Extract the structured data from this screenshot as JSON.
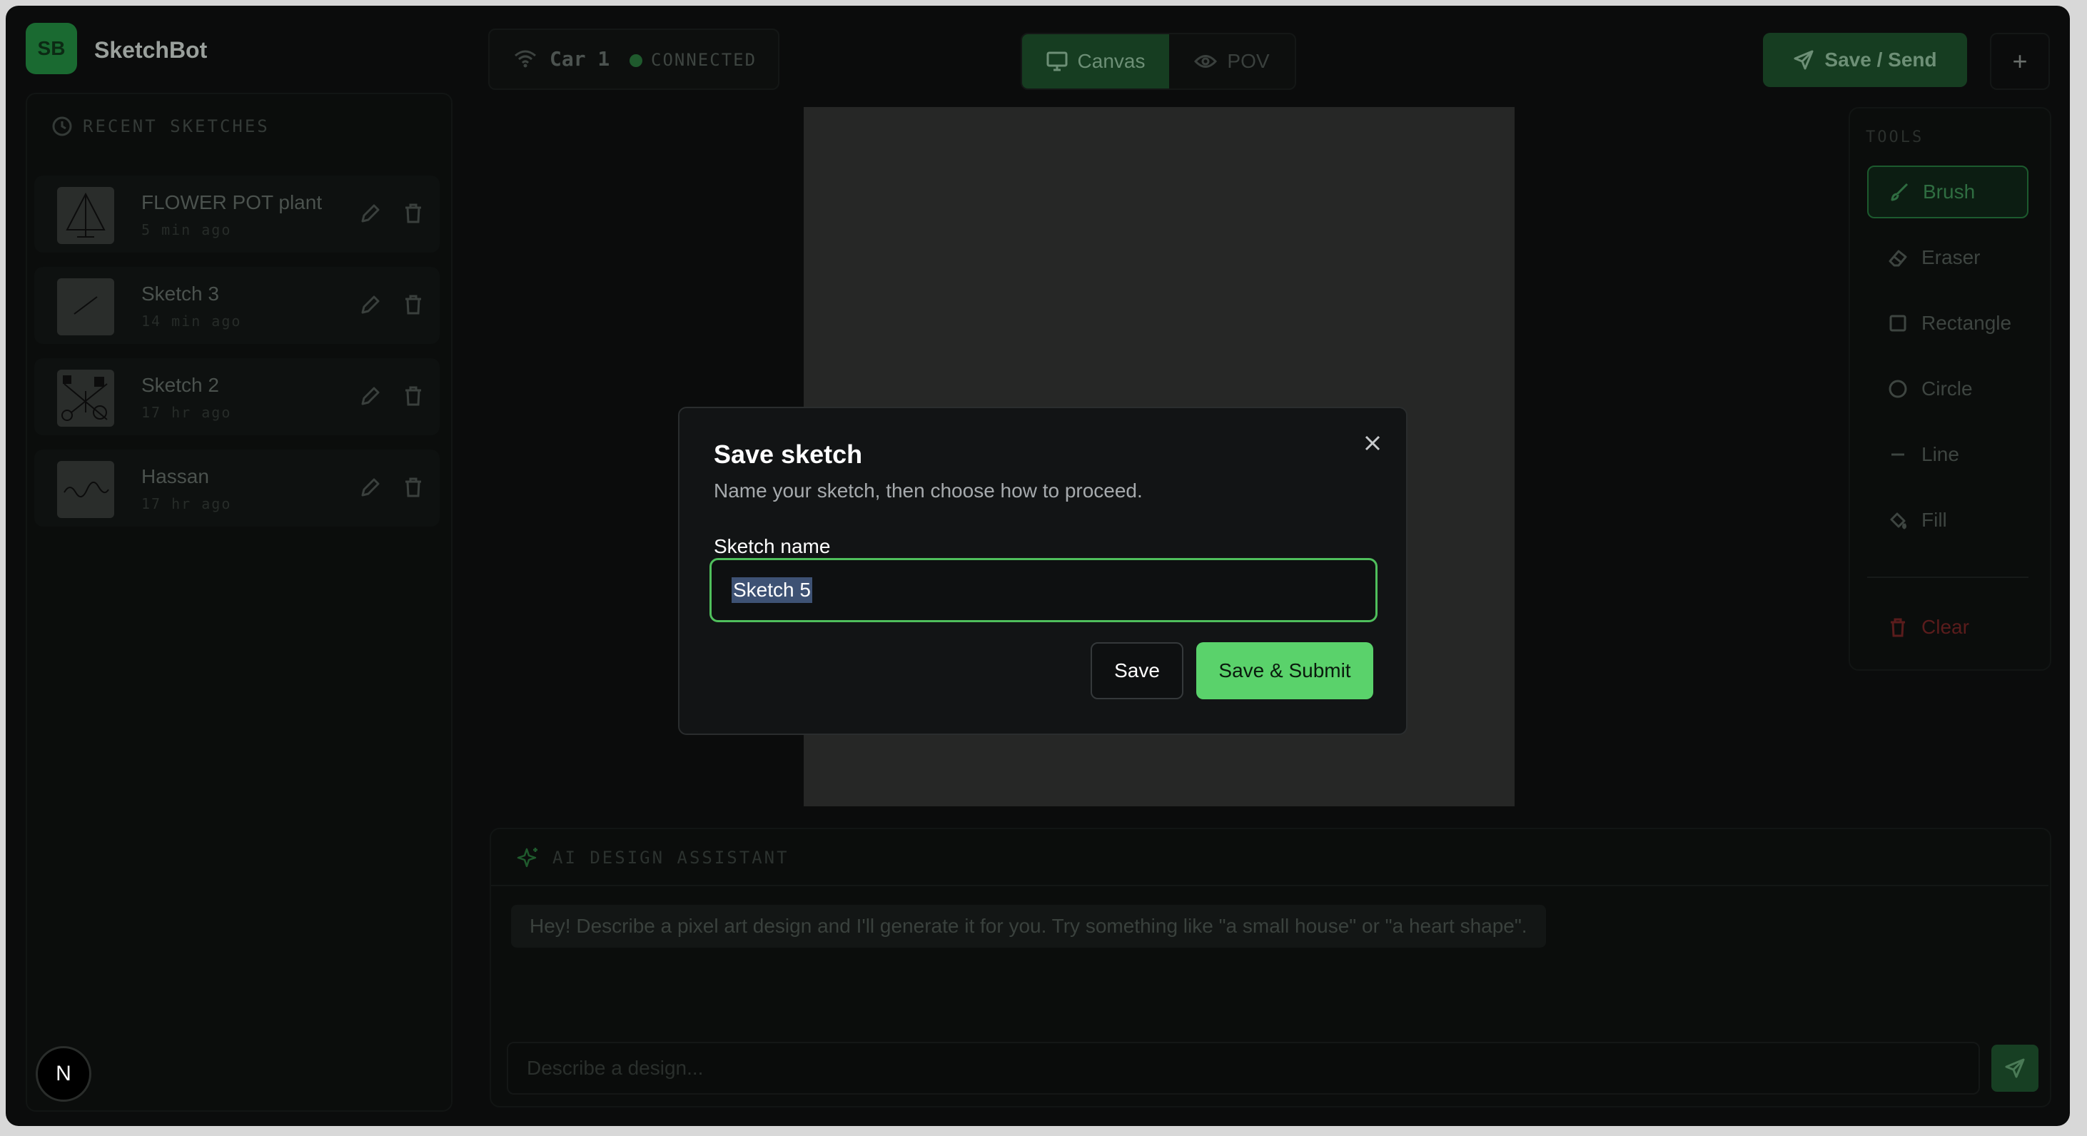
{
  "app": {
    "logo_initials": "SB",
    "title": "SketchBot"
  },
  "connection": {
    "car_label": "Car 1",
    "status": "CONNECTED",
    "status_color": "#2f9a47"
  },
  "view_modes": [
    {
      "label": "Canvas",
      "active": true
    },
    {
      "label": "POV",
      "active": false
    }
  ],
  "header": {
    "save_send_label": "Save / Send",
    "add_label": "+"
  },
  "sidebar": {
    "heading": "RECENT SKETCHES",
    "items": [
      {
        "name": "FLOWER POT plant",
        "time": "5 min ago"
      },
      {
        "name": "Sketch 3",
        "time": "14 min ago"
      },
      {
        "name": "Sketch 2",
        "time": "17 hr ago"
      },
      {
        "name": "Hassan",
        "time": "17 hr ago"
      }
    ]
  },
  "tools": {
    "heading": "TOOLS",
    "items": [
      {
        "label": "Brush",
        "icon": "brush-icon",
        "active": true
      },
      {
        "label": "Eraser",
        "icon": "eraser-icon",
        "active": false
      },
      {
        "label": "Rectangle",
        "icon": "rectangle-icon",
        "active": false
      },
      {
        "label": "Circle",
        "icon": "circle-icon",
        "active": false
      },
      {
        "label": "Line",
        "icon": "line-icon",
        "active": false
      },
      {
        "label": "Fill",
        "icon": "fill-icon",
        "active": false
      }
    ],
    "clear_label": "Clear",
    "clear_color": "#5a1c1c"
  },
  "assistant": {
    "heading": "AI DESIGN ASSISTANT",
    "message": "Hey! Describe a pixel art design and I'll generate it for you. Try something like \"a small house\" or \"a heart shape\".",
    "input_placeholder": "Describe a design..."
  },
  "modal": {
    "title": "Save sketch",
    "description": "Name your sketch, then choose how to proceed.",
    "field_label": "Sketch name",
    "field_value": "Sketch 5",
    "save_label": "Save",
    "submit_label": "Save & Submit",
    "accent_color": "#5ad26b"
  },
  "dev_badge": "N"
}
